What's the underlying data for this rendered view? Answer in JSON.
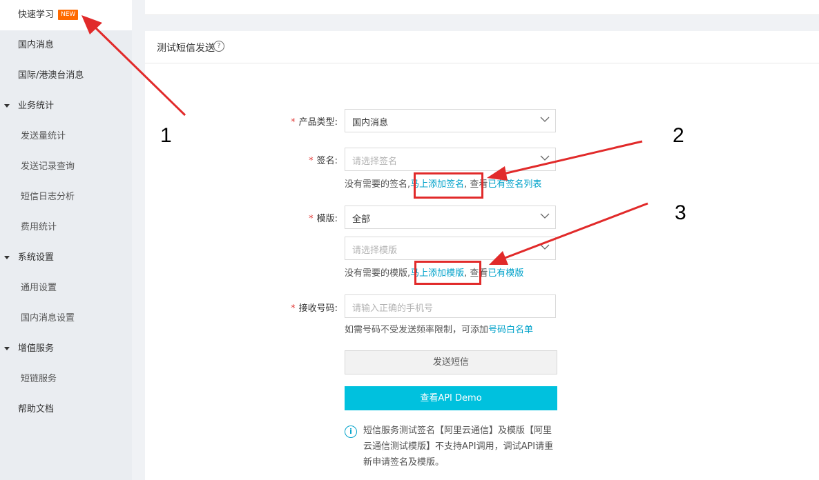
{
  "sidebar": {
    "items": [
      {
        "label": "快速学习",
        "badge": "NEW"
      },
      {
        "label": "国内消息"
      },
      {
        "label": "国际/港澳台消息"
      },
      {
        "label": "业务统计"
      },
      {
        "label": "发送量统计"
      },
      {
        "label": "发送记录查询"
      },
      {
        "label": "短信日志分析"
      },
      {
        "label": "费用统计"
      },
      {
        "label": "系统设置"
      },
      {
        "label": "通用设置"
      },
      {
        "label": "国内消息设置"
      },
      {
        "label": "增值服务"
      },
      {
        "label": "短链服务"
      },
      {
        "label": "帮助文档"
      }
    ]
  },
  "card": {
    "title": "测试短信发送",
    "help_icon": "question-circle-icon"
  },
  "form": {
    "product_type": {
      "label": "产品类型:",
      "value": "国内消息"
    },
    "signature": {
      "label": "签名:",
      "placeholder": "请选择签名",
      "hint_prefix": "没有需要的签名,",
      "add_link": "马上添加签名",
      "hint_mid": ", 查看",
      "list_link": "已有签名列表"
    },
    "template": {
      "label": "模版:",
      "value": "全部",
      "placeholder": "请选择模版",
      "hint_prefix": "没有需要的模版,",
      "add_link": "马上添加模版",
      "hint_mid": ", 查看",
      "list_link": "已有模版"
    },
    "phone": {
      "label": "接收号码:",
      "placeholder": "请输入正确的手机号",
      "hint_prefix": "如需号码不受发送频率限制，可添加",
      "whitelist_link": "号码白名单"
    },
    "required_mark": "*",
    "send_button": "发送短信",
    "api_demo_button": "查看API Demo",
    "info_icon": "info-circle-icon",
    "info_text": "短信服务测试签名【阿里云通信】及模版【阿里云通信测试模版】不支持API调用，调试API请重新申请签名及模版。"
  },
  "annotations": {
    "numbers": [
      "1",
      "2",
      "3"
    ],
    "color": "#e12a2a"
  }
}
